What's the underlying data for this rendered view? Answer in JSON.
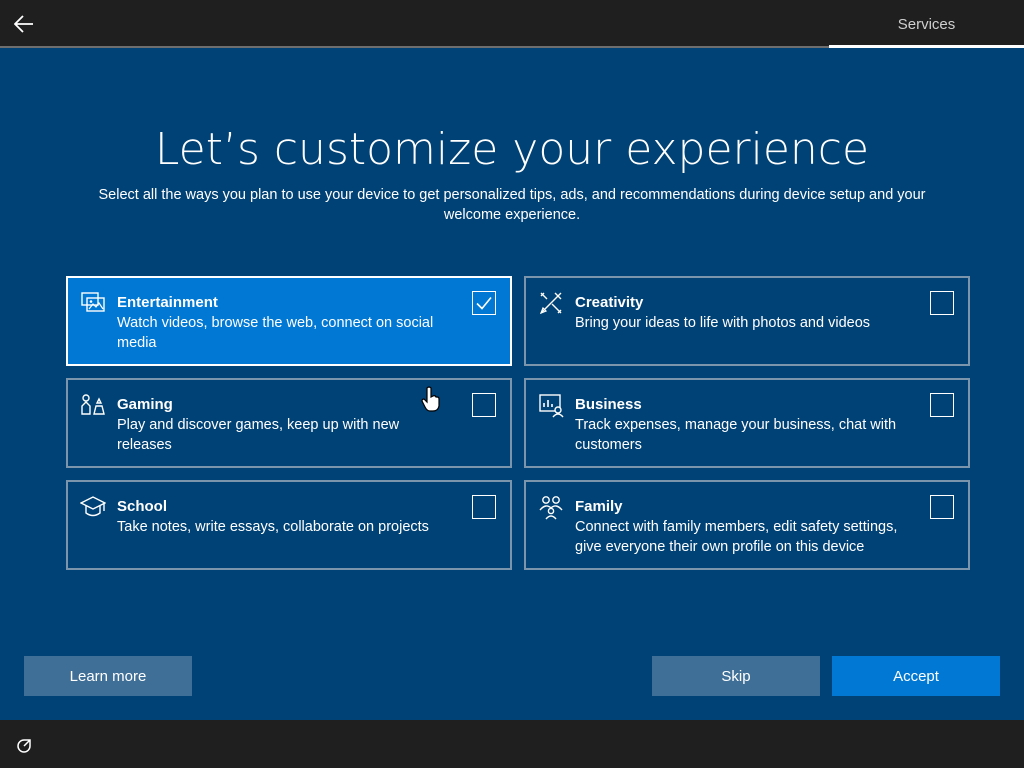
{
  "header": {
    "back_icon": "arrow-left-icon",
    "tab_label": "Services"
  },
  "main": {
    "title": "Let’s customize your experience",
    "subtitle": "Select all the ways you plan to use your device to get personalized tips, ads, and recommendations during device setup and your welcome experience."
  },
  "options": [
    {
      "title": "Entertainment",
      "desc": "Watch videos, browse the web, connect on social media",
      "icon": "entertainment-icon",
      "checked": true
    },
    {
      "title": "Creativity",
      "desc": "Bring your ideas to life with photos and videos",
      "icon": "creativity-icon",
      "checked": false
    },
    {
      "title": "Gaming",
      "desc": "Play and discover games, keep up with new releases",
      "icon": "gaming-icon",
      "checked": false
    },
    {
      "title": "Business",
      "desc": "Track expenses, manage your business, chat with customers",
      "icon": "business-icon",
      "checked": false
    },
    {
      "title": "School",
      "desc": "Take notes, write essays, collaborate on projects",
      "icon": "school-icon",
      "checked": false
    },
    {
      "title": "Family",
      "desc": "Connect with family members, edit safety settings, give everyone their own profile on this device",
      "icon": "family-icon",
      "checked": false
    }
  ],
  "buttons": {
    "learn_more": "Learn more",
    "skip": "Skip",
    "accept": "Accept"
  },
  "footer": {
    "accessibility_icon": "accessibility-icon"
  },
  "colors": {
    "background": "#004275",
    "accent": "#0078d4",
    "bar": "#1f1f1f"
  }
}
